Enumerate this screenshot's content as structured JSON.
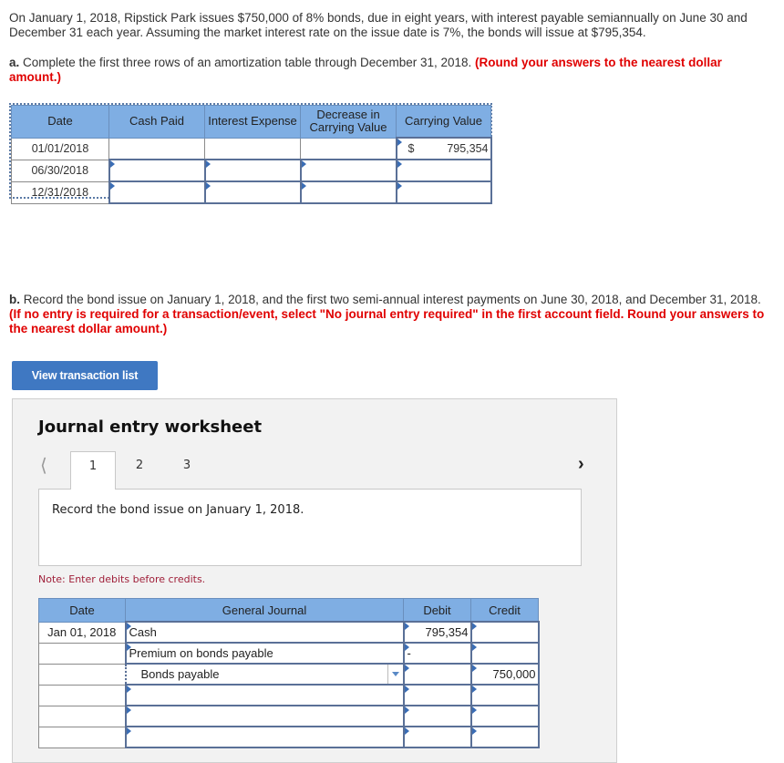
{
  "problem": {
    "intro": "On January 1, 2018, Ripstick Park issues $750,000 of 8% bonds, due in eight years, with interest payable semiannually on June 30 and December 31 each year. Assuming the market interest rate on the issue date is 7%, the bonds will issue at $795,354.",
    "part_a_label": "a.",
    "part_a_text": " Complete the first three rows of an amortization table through December 31, 2018. ",
    "part_a_instruction": "(Round your answers to the nearest dollar amount.)",
    "part_b_label": "b.",
    "part_b_text": " Record the bond issue on January 1, 2018, and the first two semi-annual interest payments on June 30, 2018, and December 31, 2018. ",
    "part_b_instruction": "(If no entry is required for a transaction/event, select \"No journal entry required\" in the first account field. Round your answers to the nearest dollar amount.)"
  },
  "amortization": {
    "headers": [
      "Date",
      "Cash Paid",
      "Interest Expense",
      "Decrease in Carrying Value",
      "Carrying Value"
    ],
    "rows": [
      {
        "date": "01/01/2018",
        "cash_paid": "",
        "interest_expense": "",
        "decrease": "",
        "currency": "$",
        "carrying_value": "795,354"
      },
      {
        "date": "06/30/2018",
        "cash_paid": "",
        "interest_expense": "",
        "decrease": "",
        "currency": "",
        "carrying_value": ""
      },
      {
        "date": "12/31/2018",
        "cash_paid": "",
        "interest_expense": "",
        "decrease": "",
        "currency": "",
        "carrying_value": ""
      }
    ]
  },
  "view_transaction_button": "View transaction list",
  "worksheet": {
    "title": "Journal entry worksheet",
    "prev_icon": "chevron-left",
    "next_icon": "chevron-right",
    "tabs": [
      "1",
      "2",
      "3"
    ],
    "active_tab": "1",
    "instruction": "Record the bond issue on January 1, 2018.",
    "note": "Note: Enter debits before credits.",
    "headers": [
      "Date",
      "General Journal",
      "Debit",
      "Credit"
    ],
    "rows": [
      {
        "date": "Jan 01, 2018",
        "account": "Cash",
        "debit": "795,354",
        "credit": ""
      },
      {
        "date": "",
        "account": "Premium on bonds payable",
        "debit": "-",
        "credit": ""
      },
      {
        "date": "",
        "account": "Bonds payable",
        "debit": "",
        "credit": "750,000"
      },
      {
        "date": "",
        "account": "",
        "debit": "",
        "credit": ""
      },
      {
        "date": "",
        "account": "",
        "debit": "",
        "credit": ""
      },
      {
        "date": "",
        "account": "",
        "debit": "",
        "credit": ""
      }
    ]
  }
}
